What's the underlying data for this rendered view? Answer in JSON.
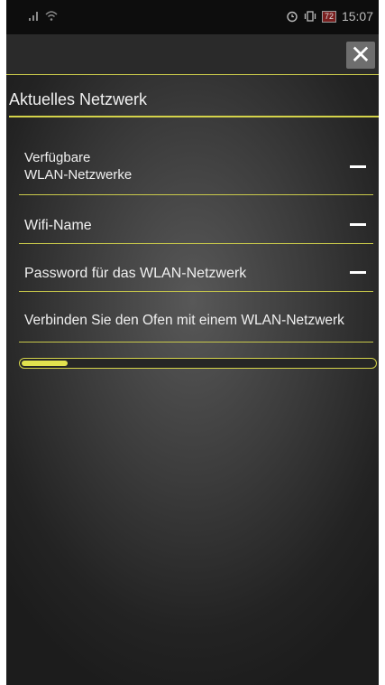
{
  "status_bar": {
    "icons": [
      "signal-icon",
      "wifi-icon",
      "alarm-icon",
      "vibrate-icon",
      "battery-icon"
    ],
    "battery": "72",
    "time": "15:07"
  },
  "toolbar": {
    "close_label": "✕"
  },
  "section": {
    "title": "Aktuelles Netzwerk"
  },
  "rows": [
    {
      "label": "Verfügbare\nWLAN-Netzwerke",
      "action": "—"
    },
    {
      "label": "Wifi-Name",
      "action": "—"
    },
    {
      "label": "Password für das WLAN-Netzwerk",
      "action": "—"
    },
    {
      "label": "Verbinden Sie den Ofen mit einem WLAN-Netzwerk"
    }
  ],
  "progress": {
    "value": 0.13
  },
  "colors": {
    "accent": "#d4d34a",
    "background": "#3b3b3b"
  }
}
